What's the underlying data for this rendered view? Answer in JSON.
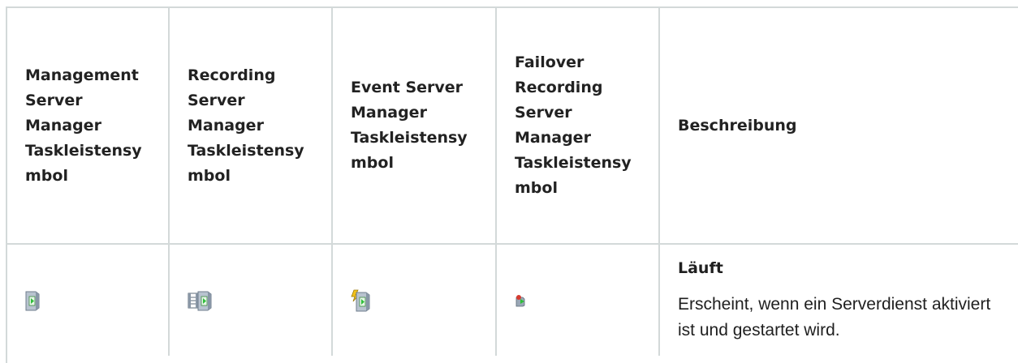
{
  "table": {
    "headers": [
      "Management Server Manager Taskleistensy mbol",
      "Recording Server Manager Taskleistensy mbol",
      "Event Server Manager Taskleistensy mbol",
      "Failover Recording Server Manager Taskleistensy mbol",
      "Beschreibung"
    ],
    "header_lines": [
      [
        "Management",
        "Server",
        "Manager",
        "Taskleistensy",
        "mbol"
      ],
      [
        "Recording",
        "Server",
        "Manager",
        "Taskleistensy",
        "mbol"
      ],
      [
        "Event Server",
        "Manager",
        "Taskleistensy",
        "mbol"
      ],
      [
        "Failover",
        "Recording",
        "Server",
        "Manager",
        "Taskleistensy",
        "mbol"
      ],
      [
        "Beschreibung"
      ]
    ],
    "rows": [
      {
        "icons": [
          "management-server-running-icon",
          "recording-server-running-icon",
          "event-server-running-icon",
          "failover-recording-server-running-icon"
        ],
        "state": "Läuft",
        "description": "Erscheint, wenn ein Serverdienst aktiviert ist und gestartet wird."
      }
    ]
  },
  "colors": {
    "border": "#d3d9d9",
    "icon_play": "#2fbf3a",
    "icon_body": "#b8c3cf"
  }
}
